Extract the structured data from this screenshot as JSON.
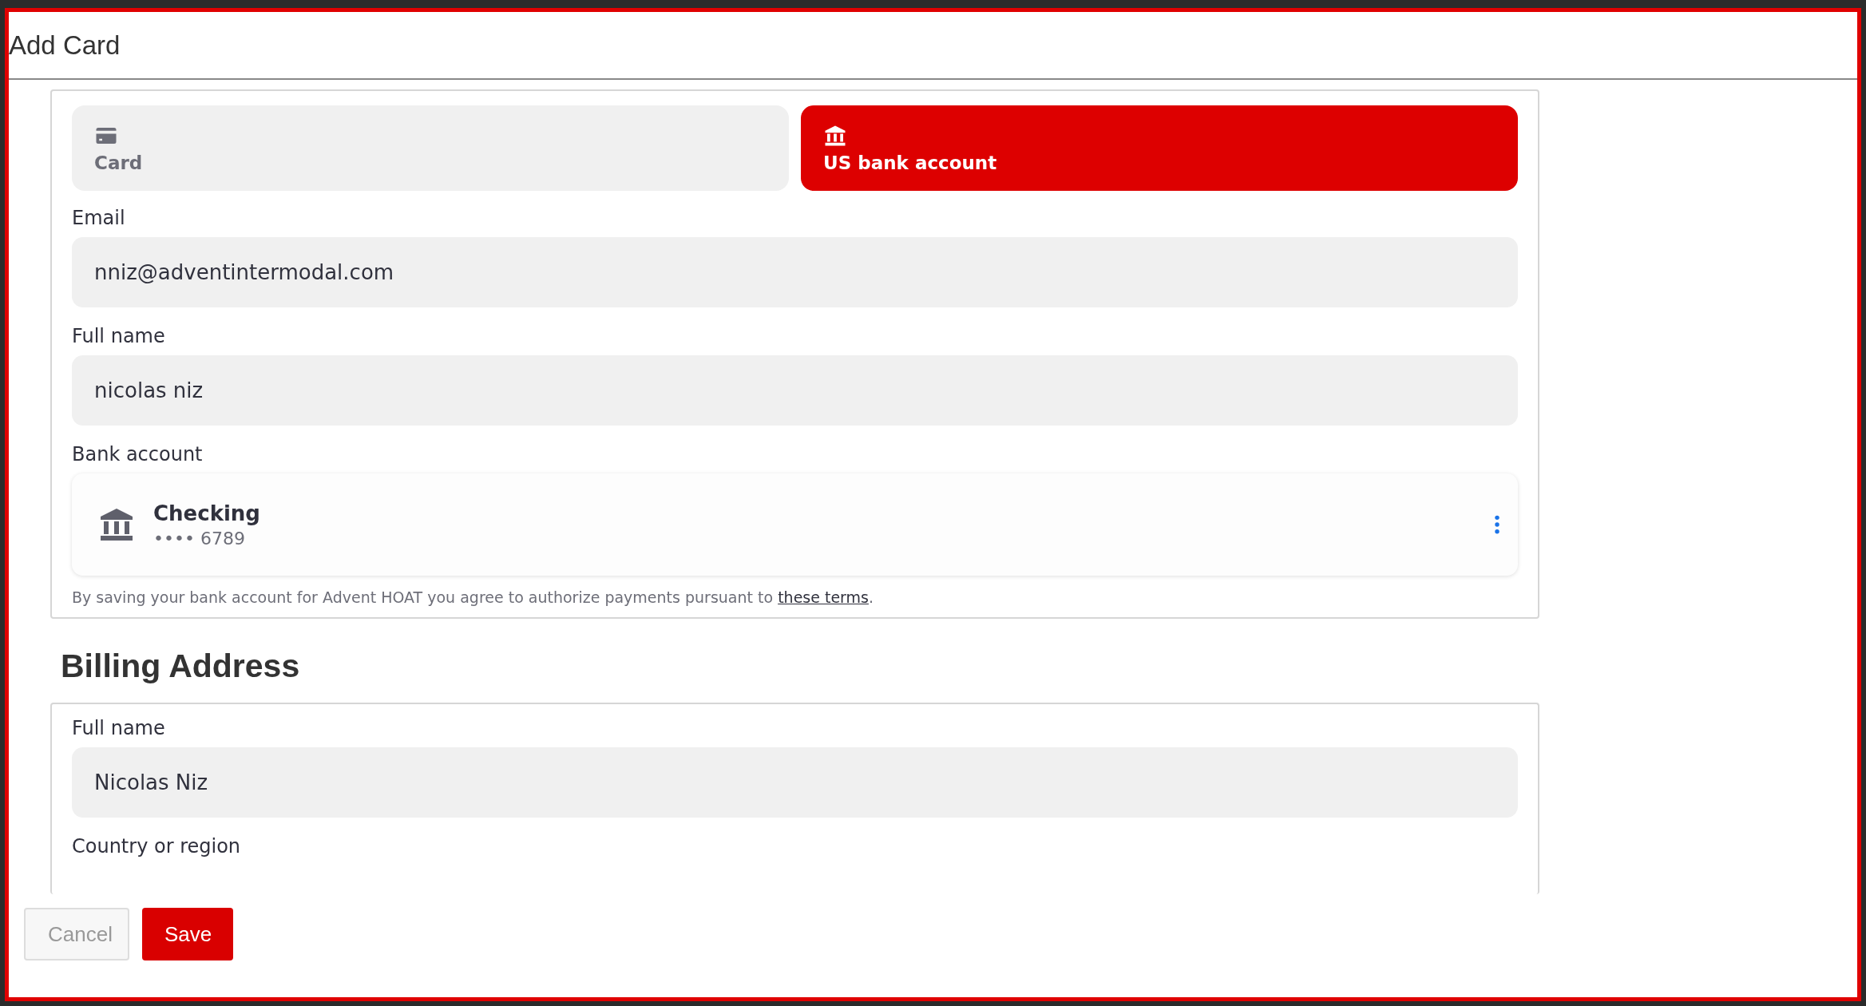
{
  "window": {
    "title": "Add Card"
  },
  "payment_tabs": [
    {
      "kind": "card",
      "label": "Card",
      "selected": false
    },
    {
      "kind": "bank",
      "label": "US bank account",
      "selected": true
    }
  ],
  "payment_fields": [
    {
      "label": "Email",
      "value": "nniz@adventintermodal.com"
    },
    {
      "label": "Full name",
      "value": "nicolas niz"
    }
  ],
  "bank_account": {
    "label": "Bank account",
    "name": "Checking",
    "number": "•••• 6789"
  },
  "terms": {
    "text": "By saving your bank account for Advent HOAT you agree to authorize payments pursuant to ",
    "link": "these terms",
    "after": "."
  },
  "billing": {
    "heading": "Billing Address",
    "fields": [
      {
        "label": "Full name",
        "value": "Nicolas Niz"
      }
    ],
    "next_label": "Country or region"
  },
  "buttons": [
    {
      "kind": "secondary",
      "label": "Cancel"
    },
    {
      "kind": "primary",
      "label": "Save"
    }
  ]
}
